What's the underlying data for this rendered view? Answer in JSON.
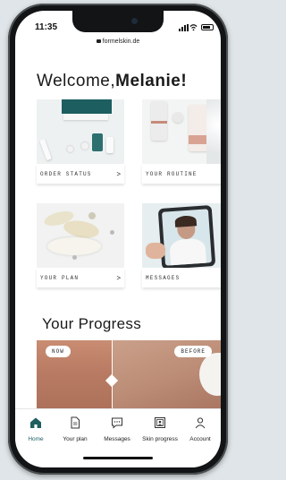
{
  "status_bar": {
    "time": "11:35"
  },
  "browser": {
    "url": "formelskin.de"
  },
  "greeting": {
    "prefix": "Welcome,",
    "name": "Melanie!"
  },
  "cards": [
    {
      "label": "ORDER STATUS",
      "arrow": ">"
    },
    {
      "label": "YOUR ROUTINE",
      "arrow": ">"
    },
    {
      "label": "YOUR PLAN",
      "arrow": ">"
    },
    {
      "label": "MESSAGES",
      "arrow": ">"
    }
  ],
  "progress": {
    "title": "Your Progress",
    "now_label": "NOW",
    "before_label": "BEFORE"
  },
  "tabs": [
    {
      "label": "Home",
      "icon": "home-icon",
      "active": true
    },
    {
      "label": "Your plan",
      "icon": "document-icon",
      "active": false
    },
    {
      "label": "Messages",
      "icon": "chat-icon",
      "active": false
    },
    {
      "label": "Skin progress",
      "icon": "photo-icon",
      "active": false
    },
    {
      "label": "Account",
      "icon": "person-icon",
      "active": false
    }
  ],
  "colors": {
    "accent": "#1d5e60",
    "background": "#ffffff"
  }
}
